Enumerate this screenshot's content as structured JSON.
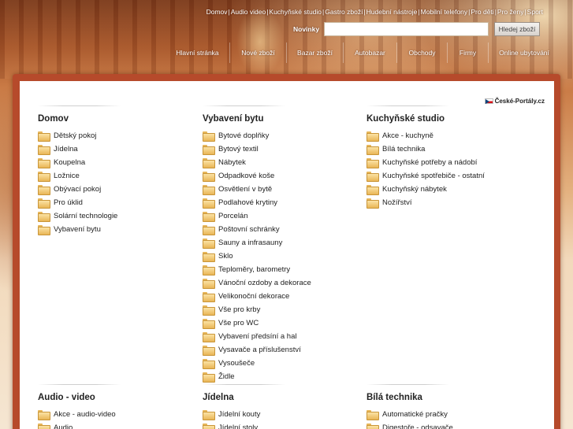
{
  "top_links": [
    "Domov",
    "Audio video",
    "Kuchyňské studio",
    "Gastro zboží",
    "Hudební nástroje",
    "Mobilní telefony",
    "Pro děti",
    "Pro ženy",
    "Sport"
  ],
  "search": {
    "label": "Novinky",
    "value": "",
    "button": "Hledej zboží"
  },
  "nav": [
    "Hlavní stránka",
    "Nové zboží",
    "Bazar zboží",
    "Autobazar",
    "Obchody",
    "Firmy",
    "Online ubytování"
  ],
  "portal_link": "České-Portály.cz",
  "columns": [
    {
      "title": "Domov",
      "items": [
        "Dětský pokoj",
        "Jídelna",
        "Koupelna",
        "Ložnice",
        "Obývací pokoj",
        "Pro úklid",
        "Solární technologie",
        "Vybavení bytu"
      ]
    },
    {
      "title": "Vybavení bytu",
      "items": [
        "Bytové doplňky",
        "Bytový textil",
        "Nábytek",
        "Odpadkové koše",
        "Osvětlení v bytě",
        "Podlahové krytiny",
        "Porcelán",
        "Poštovní schránky",
        "Sauny a infrasauny",
        "Sklo",
        "Teploměry, barometry",
        "Vánoční ozdoby a dekorace",
        "Velikonoční dekorace",
        "Vše pro krby",
        "Vše pro WC",
        "Vybavení předsíní a hal",
        "Vysavače a příslušenství",
        "Vysoušeče",
        "Židle"
      ]
    },
    {
      "title": "Kuchyňské studio",
      "items": [
        "Akce - kuchyně",
        "Bílá technika",
        "Kuchyňské potřeby a nádobí",
        "Kuchyňské spotřebiče - ostatní",
        "Kuchyňský nábytek",
        "Nožířství"
      ]
    },
    {
      "title": "Audio - video",
      "items": [
        "Akce - audio-video",
        "Audio"
      ]
    },
    {
      "title": "Jídelna",
      "items": [
        "Jídelní kouty",
        "Jídelní stoly"
      ]
    },
    {
      "title": "Bílá technika",
      "items": [
        "Automatické pračky",
        "Digestoře - odsavače"
      ]
    }
  ]
}
